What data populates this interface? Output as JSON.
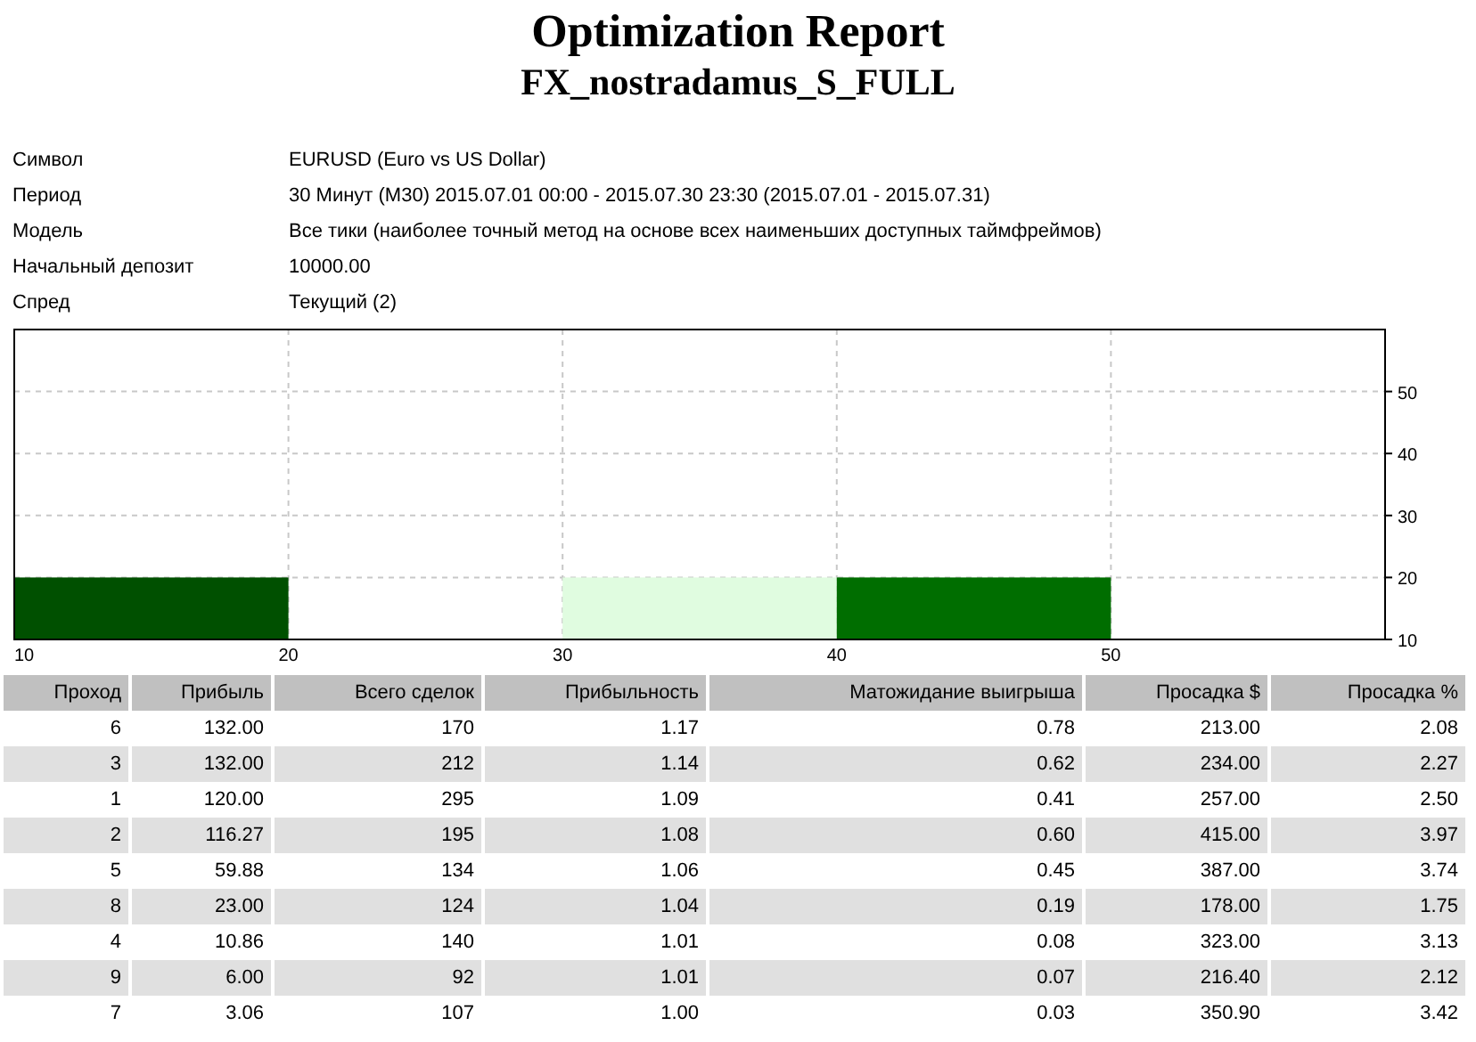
{
  "title": "Optimization Report",
  "subtitle": "FX_nostradamus_S_FULL",
  "info": [
    {
      "label": "Символ",
      "value": "EURUSD (Euro vs US Dollar)"
    },
    {
      "label": "Период",
      "value": "30 Минут (M30) 2015.07.01 00:00 - 2015.07.30 23:30 (2015.07.01 - 2015.07.31)"
    },
    {
      "label": "Модель",
      "value": "Все тики (наиболее точный метод на основе всех наименьших доступных таймфреймов)"
    },
    {
      "label": "Начальный депозит",
      "value": "10000.00"
    },
    {
      "label": "Спред",
      "value": "Текущий (2)"
    }
  ],
  "chart": {
    "chart_data": {
      "type": "bar",
      "x": [
        15,
        25,
        35,
        45
      ],
      "grid": true,
      "xlim": [
        10,
        60
      ],
      "ylim": [
        10,
        60
      ],
      "xticks": [
        10,
        20,
        30,
        40,
        50
      ],
      "yticks": [
        10,
        20,
        30,
        40,
        50
      ],
      "series": [
        {
          "color": "#005000",
          "values": [
            20,
            null,
            null,
            null
          ]
        },
        {
          "color": "#e0fce0",
          "values": [
            null,
            null,
            20,
            null
          ]
        },
        {
          "color": "#006e00",
          "values": [
            null,
            null,
            null,
            20
          ]
        }
      ]
    }
  },
  "table": {
    "columns": [
      "Проход",
      "Прибыль",
      "Всего сделок",
      "Прибыльность",
      "Матожидание выигрыша",
      "Просадка $",
      "Просадка %"
    ],
    "rows": [
      [
        "6",
        "132.00",
        "170",
        "1.17",
        "0.78",
        "213.00",
        "2.08"
      ],
      [
        "3",
        "132.00",
        "212",
        "1.14",
        "0.62",
        "234.00",
        "2.27"
      ],
      [
        "1",
        "120.00",
        "295",
        "1.09",
        "0.41",
        "257.00",
        "2.50"
      ],
      [
        "2",
        "116.27",
        "195",
        "1.08",
        "0.60",
        "415.00",
        "3.97"
      ],
      [
        "5",
        "59.88",
        "134",
        "1.06",
        "0.45",
        "387.00",
        "3.74"
      ],
      [
        "8",
        "23.00",
        "124",
        "1.04",
        "0.19",
        "178.00",
        "1.75"
      ],
      [
        "4",
        "10.86",
        "140",
        "1.01",
        "0.08",
        "323.00",
        "3.13"
      ],
      [
        "9",
        "6.00",
        "92",
        "1.01",
        "0.07",
        "216.40",
        "2.12"
      ],
      [
        "7",
        "3.06",
        "107",
        "1.00",
        "0.03",
        "350.90",
        "3.42"
      ]
    ]
  }
}
